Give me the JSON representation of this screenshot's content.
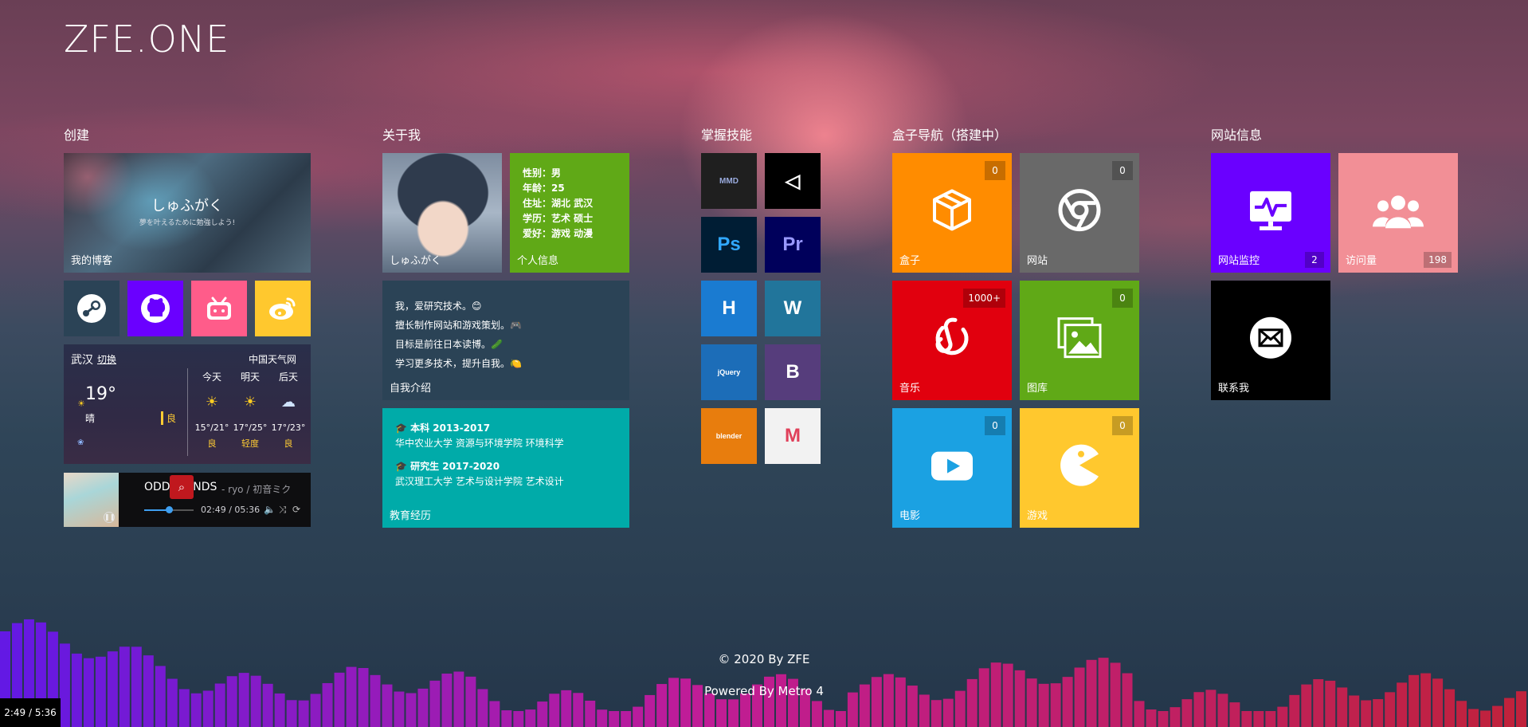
{
  "site": {
    "title": "ZFE.ONE"
  },
  "groups": {
    "create": "创建",
    "about": "关于我",
    "skills": "掌握技能",
    "nav": "盒子导航（搭建中）",
    "site_info": "网站信息"
  },
  "create": {
    "blog": {
      "title": "しゅふがく",
      "subtitle": "夢を叶えるために勉強しよう!",
      "label": "我的博客"
    },
    "socials": [
      {
        "name": "steam",
        "color": "#2b4356"
      },
      {
        "name": "github",
        "color": "#6a00ff"
      },
      {
        "name": "bilibili",
        "color": "#ff5c8a"
      },
      {
        "name": "weibo",
        "color": "#ffc82e"
      }
    ],
    "weather": {
      "city": "武汉",
      "switch_label": "切换",
      "source": "中国天气网",
      "temp": "19°",
      "condition": "晴",
      "aqi": "良",
      "days": [
        {
          "name": "今天",
          "range": "15°/21°",
          "aqi": "良",
          "icon": "sun"
        },
        {
          "name": "明天",
          "range": "17°/25°",
          "aqi": "轻度",
          "icon": "sun"
        },
        {
          "name": "后天",
          "range": "17°/23°",
          "aqi": "良",
          "icon": "cloud-rain"
        }
      ]
    },
    "player": {
      "song": "ODDS&ENDS",
      "artist": "- ryo / 初音ミク",
      "time": "02:49 / 05:36",
      "progress": 0.5
    }
  },
  "about": {
    "avatar_label": "しゅふがく",
    "info": {
      "label": "个人信息",
      "lines": [
        "性别：男",
        "年龄：25",
        "住址：湖北 武汉",
        "学历：艺术 硕士",
        "爱好：游戏 动漫"
      ]
    },
    "intro": {
      "label": "自我介绍",
      "lines": [
        "我，爱研究技术。😊",
        "擅长制作网站和游戏策划。🎮",
        "目标是前往日本读博。🥒",
        "学习更多技术，提升自我。🍋"
      ]
    },
    "education": {
      "label": "教育经历",
      "entries": [
        {
          "head": "🎓  本科   2013-2017",
          "body": "华中农业大学 资源与环境学院 环境科学"
        },
        {
          "head": "🎓  研究生   2017-2020",
          "body": "武汉理工大学 艺术与设计学院 艺术设计"
        }
      ]
    }
  },
  "skills": [
    {
      "name": "MMD",
      "text": "MMD",
      "bg": "#1f1f1f",
      "fg": "#9ad"
    },
    {
      "name": "Unity",
      "text": "◁",
      "bg": "#000000",
      "fg": "#ffffff"
    },
    {
      "name": "Photoshop",
      "text": "Ps",
      "bg": "#001d34",
      "fg": "#31a8ff"
    },
    {
      "name": "Premiere",
      "text": "Pr",
      "bg": "#00005b",
      "fg": "#9999ff"
    },
    {
      "name": "HTML5",
      "text": "H",
      "bg": "#1a7bd1",
      "fg": "#ffffff"
    },
    {
      "name": "WordPress",
      "text": "W",
      "bg": "#21759b",
      "fg": "#ffffff"
    },
    {
      "name": "jQuery",
      "text": "jQuery",
      "bg": "#1c6db8",
      "fg": "#ffffff"
    },
    {
      "name": "Bootstrap",
      "text": "B",
      "bg": "#563d7c",
      "fg": "#ffffff"
    },
    {
      "name": "Blender",
      "text": "blender",
      "bg": "#e87d0d",
      "fg": "#ffffff"
    },
    {
      "name": "Mail",
      "text": "M",
      "bg": "#f2f2f2",
      "fg": "#e0405a"
    }
  ],
  "nav": [
    {
      "label": "盒子",
      "badge": "0",
      "icon": "box-icon",
      "color": "#ff8c00"
    },
    {
      "label": "网站",
      "badge": "0",
      "icon": "chrome-icon",
      "color": "#696969"
    },
    {
      "label": "音乐",
      "badge": "1000+",
      "icon": "netease-music-icon",
      "color": "#e1000e"
    },
    {
      "label": "图库",
      "badge": "0",
      "icon": "gallery-icon",
      "color": "#60a917"
    },
    {
      "label": "电影",
      "badge": "0",
      "icon": "play-icon",
      "color": "#1ba1e2"
    },
    {
      "label": "游戏",
      "badge": "0",
      "icon": "pacman-icon",
      "color": "#ffc82e"
    }
  ],
  "site_info": [
    {
      "label": "网站监控",
      "badge": "2",
      "icon": "monitor-icon",
      "color": "#6a00ff"
    },
    {
      "label": "访问量",
      "badge": "198",
      "icon": "users-icon",
      "color": "#f28f96"
    },
    {
      "label": "联系我",
      "badge": "",
      "icon": "mail-icon",
      "color": "#000000"
    }
  ],
  "footer": {
    "copyright": "© 2020 By ZFE",
    "powered": "Powered By Metro 4"
  },
  "player_chip": {
    "time": "2:49 / 5:36"
  }
}
